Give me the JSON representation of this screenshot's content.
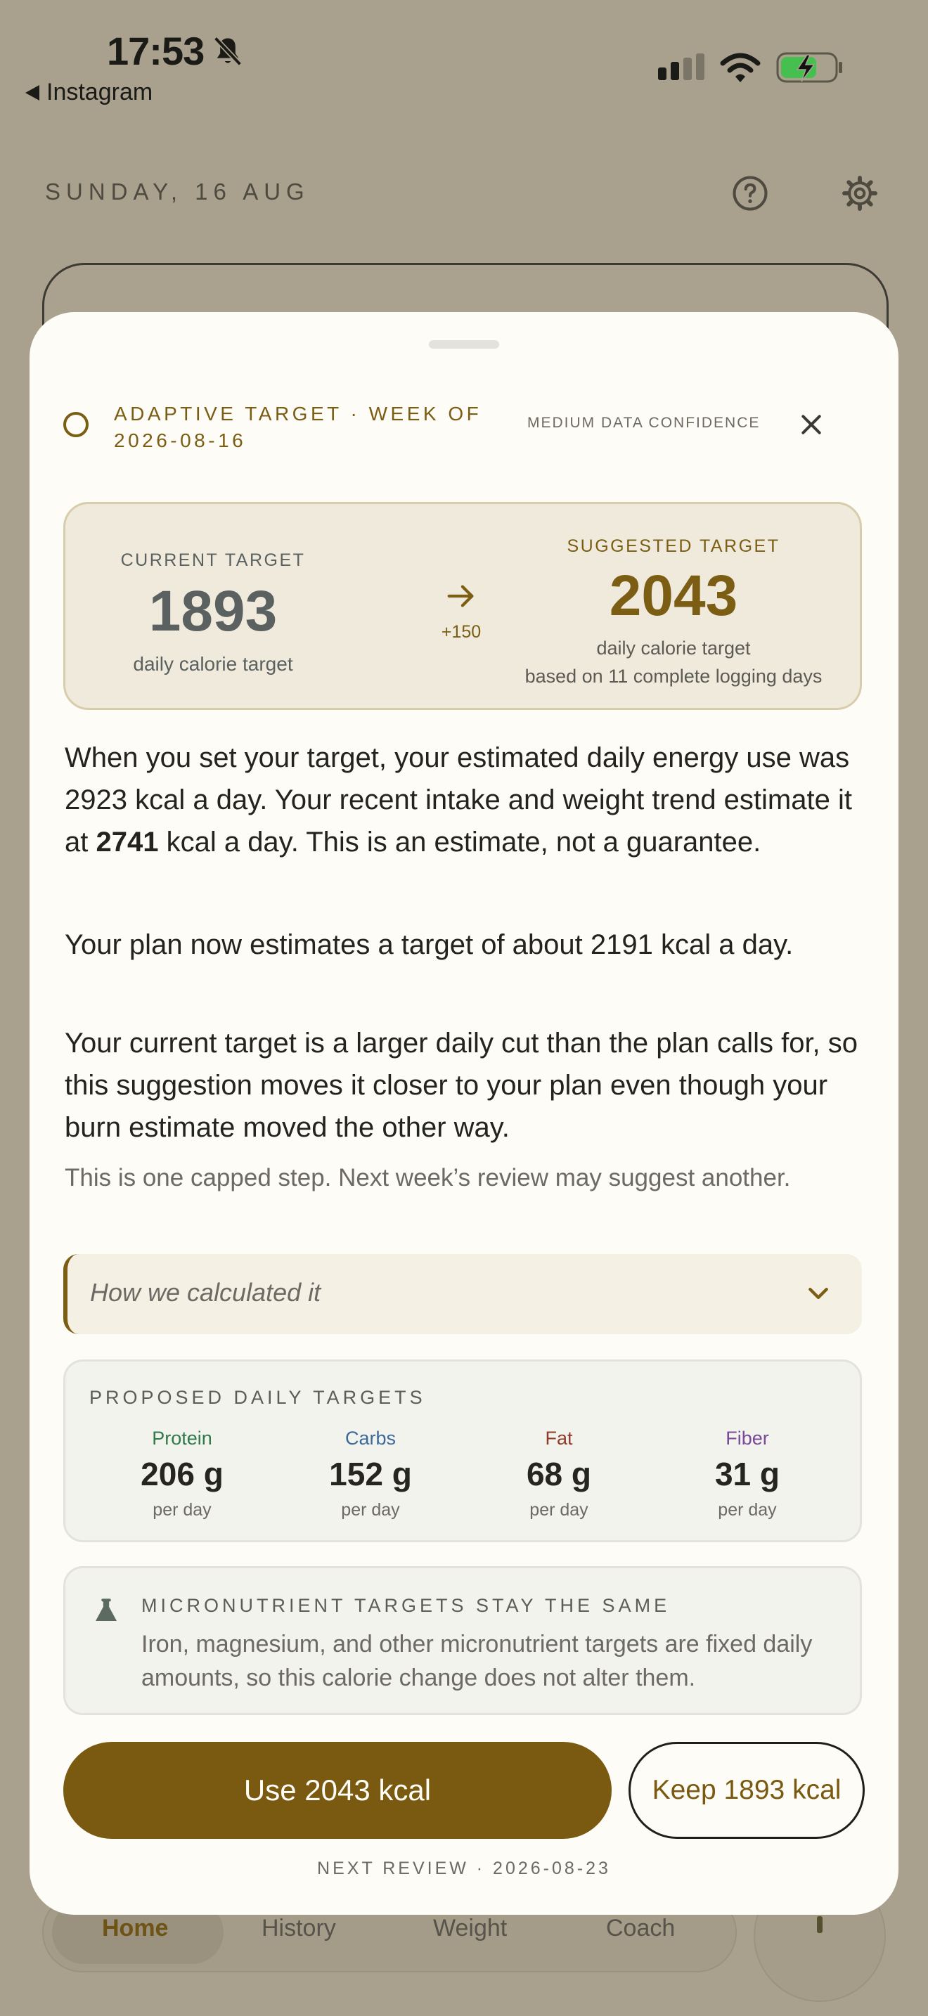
{
  "status_bar": {
    "time": "17:53",
    "back_app": "Instagram"
  },
  "background": {
    "date_heading": "SUNDAY, 16 AUG",
    "nav": {
      "home": "Home",
      "history": "History",
      "weight": "Weight",
      "coach": "Coach"
    }
  },
  "sheet": {
    "header": {
      "title": "ADAPTIVE TARGET · WEEK OF 2026-08-16",
      "confidence": "MEDIUM DATA CONFIDENCE"
    },
    "target_card": {
      "current_label": "CURRENT TARGET",
      "current_value": "1893",
      "current_sub": "daily calorie target",
      "delta": "+150",
      "suggested_label": "SUGGESTED TARGET",
      "suggested_value": "2043",
      "suggested_sub": "daily calorie target",
      "suggested_basis": "based on 11 complete logging days"
    },
    "paragraph1": {
      "before": "When you set your target, your estimated daily energy use was 2923 kcal a day. Your recent intake and weight trend estimate it at ",
      "bold": "2741",
      "after": " kcal a day. This is an estimate, not a guarantee."
    },
    "paragraph2": "Your plan now estimates a target of about 2191 kcal a day.",
    "paragraph3": "Your current target is a larger daily cut than the plan calls for, so this suggestion moves it closer to your plan even though your burn estimate moved the other way.",
    "note": "This is one capped step. Next week’s review may suggest another.",
    "calc_label": "How we calculated it",
    "macros": {
      "title": "PROPOSED DAILY TARGETS",
      "items": [
        {
          "name": "Protein",
          "value": "206 g",
          "per": "per day",
          "color": "#2f7a4a"
        },
        {
          "name": "Carbs",
          "value": "152 g",
          "per": "per day",
          "color": "#3d6a9a"
        },
        {
          "name": "Fat",
          "value": "68 g",
          "per": "per day",
          "color": "#8f3b2a"
        },
        {
          "name": "Fiber",
          "value": "31 g",
          "per": "per day",
          "color": "#7a4a9a"
        }
      ]
    },
    "micro": {
      "title": "MICRONUTRIENT TARGETS STAY THE SAME",
      "body": "Iron, magnesium, and other micronutrient targets are fixed daily amounts, so this calorie change does not alter them."
    },
    "buttons": {
      "use": "Use 2043 kcal",
      "keep": "Keep 1893 kcal"
    },
    "next_review": "NEXT REVIEW · 2026-08-23"
  },
  "colors": {
    "accent": "#7a5a10",
    "sheet_bg": "#fdfcf7",
    "scrim": "#a9a18e"
  },
  "icons": [
    "bell-slash-icon",
    "back-triangle-icon",
    "cellular-signal-icon",
    "wifi-icon",
    "battery-charging-icon",
    "help-icon",
    "gear-icon",
    "circle-icon",
    "close-icon",
    "arrow-right-icon",
    "chevron-down-icon",
    "flask-icon"
  ]
}
